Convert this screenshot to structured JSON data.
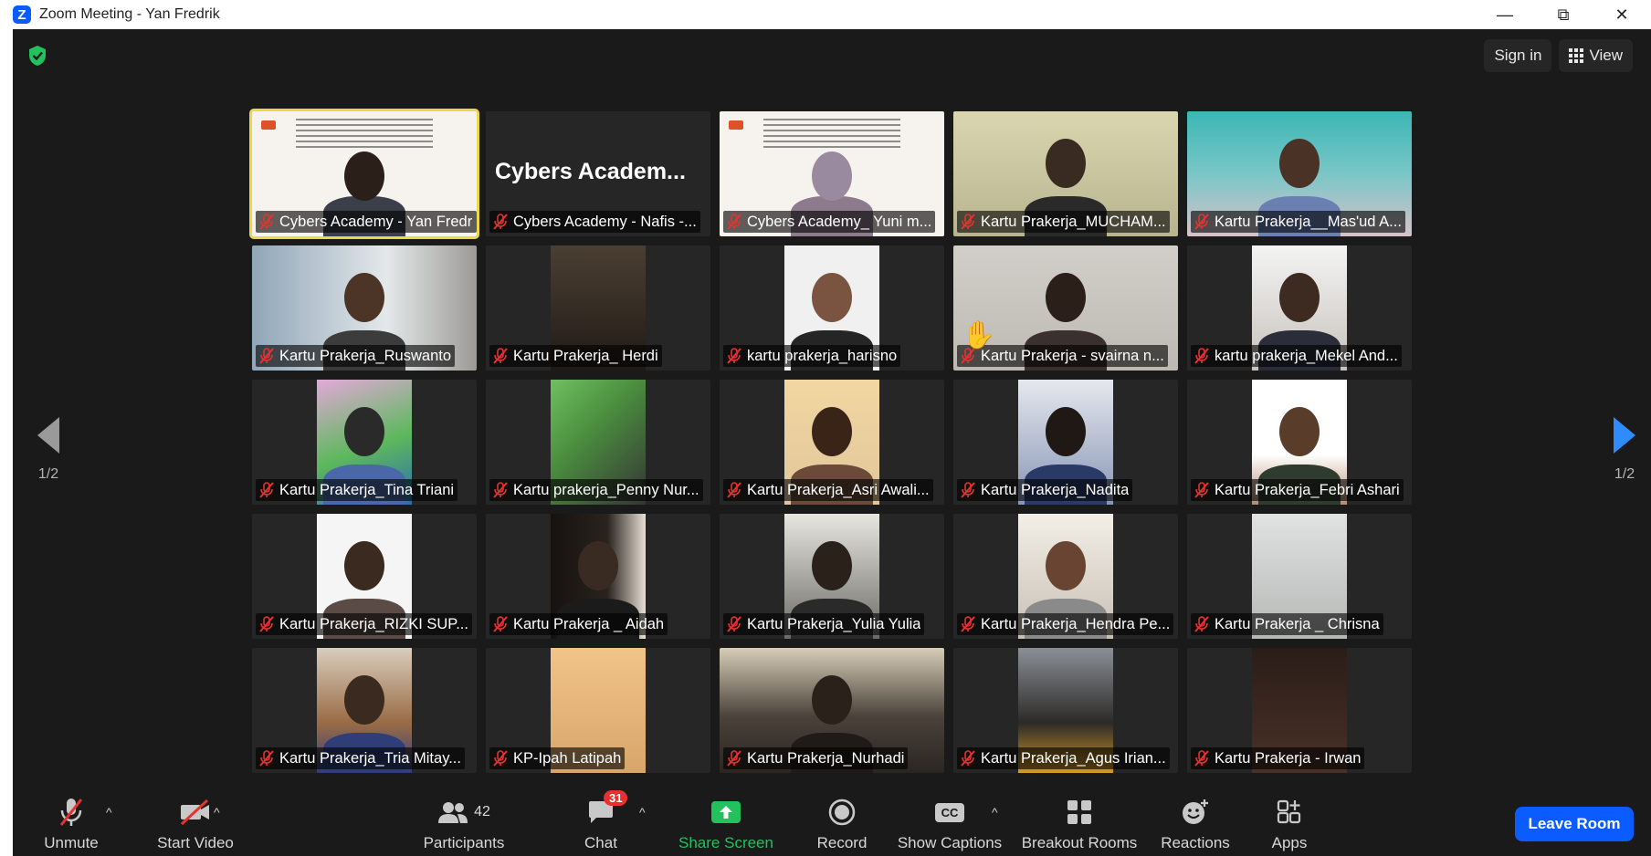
{
  "window": {
    "title": "Zoom Meeting - Yan Fredrik",
    "minimize": "—",
    "restore": "⧉",
    "close": "✕"
  },
  "header": {
    "sign_in": "Sign in",
    "view": "View"
  },
  "pager": {
    "left_page": "1/2",
    "right_page": "1/2"
  },
  "slide_tile_heading": "Cybers  Academ...",
  "participants_tiles": [
    {
      "name": "Cybers Academy - Yan Fredri..."
    },
    {
      "name": "Cybers Academy - Nafis -..."
    },
    {
      "name": "Cybers Academy_ Yuni m..."
    },
    {
      "name": "Kartu Prakerja_MUCHAM..."
    },
    {
      "name": "Kartu Prakerja__Mas'ud A..."
    },
    {
      "name": "Kartu Prakerja_Ruswanto"
    },
    {
      "name": "Kartu Prakerja_ Herdi"
    },
    {
      "name": "kartu prakerja_harisno"
    },
    {
      "name": "Kartu Prakerja - svairna n..."
    },
    {
      "name": "kartu prakerja_Mekel And..."
    },
    {
      "name": "Kartu Prakerja_Tina Triani"
    },
    {
      "name": "Kartu prakerja_Penny Nur..."
    },
    {
      "name": "Kartu Prakerja_Asri Awali..."
    },
    {
      "name": "Kartu Prakerja_Nadita"
    },
    {
      "name": "Kartu Prakerja_Febri Ashari"
    },
    {
      "name": "Kartu Prakerja_RIZKI SUP..."
    },
    {
      "name": "Kartu Prakerja _ Aidah"
    },
    {
      "name": "Kartu Prakerja_Yulia Yulia"
    },
    {
      "name": "Kartu Prakerja_Hendra Pe..."
    },
    {
      "name": "Kartu Prakerja _ Chrisna"
    },
    {
      "name": "Kartu Prakerja_Tria Mitay..."
    },
    {
      "name": "KP-Ipah Latipah"
    },
    {
      "name": "Kartu Prakerja_Nurhadi"
    },
    {
      "name": "Kartu Prakerja_Agus Irian..."
    },
    {
      "name": "Kartu Prakerja - Irwan"
    }
  ],
  "toolbar": {
    "unmute": "Unmute",
    "start_video": "Start Video",
    "participants": "Participants",
    "participants_count": "42",
    "chat": "Chat",
    "chat_badge": "31",
    "share_screen": "Share Screen",
    "record": "Record",
    "show_captions": "Show Captions",
    "captions_icon_text": "CC",
    "breakout_rooms": "Breakout Rooms",
    "reactions": "Reactions",
    "apps": "Apps",
    "caret": "^",
    "leave_room": "Leave Room"
  },
  "colors": {
    "accent_blue": "#0b5cff",
    "active_speaker": "#e8d84a",
    "mic_muted_red": "#e8312f",
    "share_green": "#23c15e",
    "background": "#1a1a1a"
  }
}
